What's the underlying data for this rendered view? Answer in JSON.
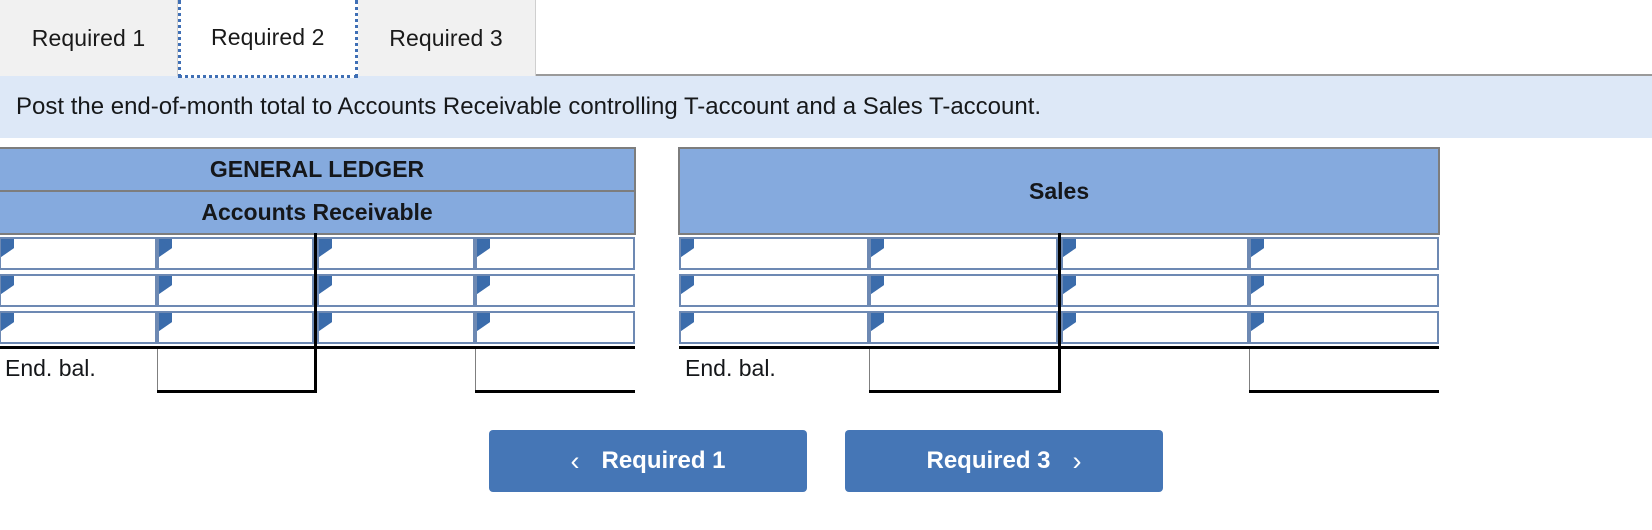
{
  "tabs": [
    {
      "label": "Required 1",
      "active": false
    },
    {
      "label": "Required 2",
      "active": true
    },
    {
      "label": "Required 3",
      "active": false
    }
  ],
  "instruction": {
    "text": "Post the end-of-month total to Accounts Receivable controlling T-account and a Sales T-account."
  },
  "ledger": {
    "title": "GENERAL LEDGER",
    "account_name": "Accounts Receivable",
    "end_balance_label": "End. bal.",
    "rows": [
      {
        "cells": [
          "",
          "",
          "",
          ""
        ]
      },
      {
        "cells": [
          "",
          "",
          "",
          ""
        ]
      },
      {
        "cells": [
          "",
          "",
          "",
          ""
        ]
      }
    ],
    "end_balance_cells": [
      "",
      "",
      ""
    ]
  },
  "sales": {
    "title": "Sales",
    "end_balance_label": "End. bal.",
    "rows": [
      {
        "cells": [
          "",
          "",
          "",
          ""
        ]
      },
      {
        "cells": [
          "",
          "",
          "",
          ""
        ]
      },
      {
        "cells": [
          "",
          "",
          "",
          ""
        ]
      }
    ],
    "end_balance_cells": [
      "",
      "",
      ""
    ]
  },
  "footer": {
    "prev_label": "Required 1",
    "next_label": "Required 3",
    "prev_icon": "chevron-left-icon",
    "next_icon": "chevron-right-icon",
    "prev_chevron": "‹",
    "next_chevron": "›"
  },
  "colors": {
    "header_blue": "#85aade",
    "instruction_blue": "#dde8f7",
    "button_blue": "#4576b6",
    "cell_border_blue": "#6d89b3",
    "triangle_blue": "#3b6cab"
  }
}
